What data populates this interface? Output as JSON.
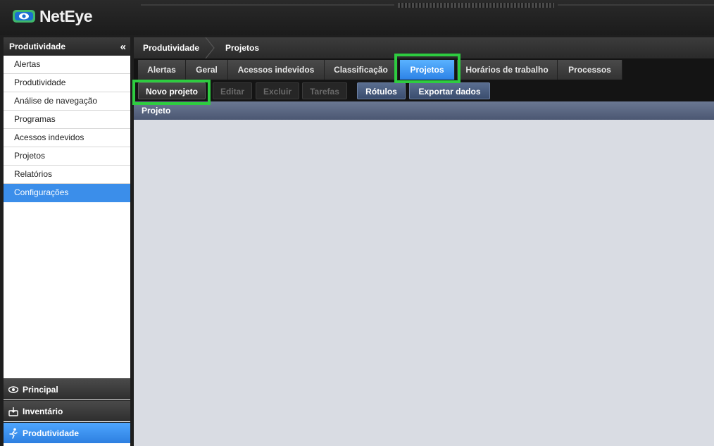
{
  "app": {
    "name": "NetEye",
    "brand_colors": {
      "header": "#1b1b1b",
      "accent": "#3b8eea",
      "highlight": "#2ecc40",
      "logo_blue": "#1b6fd1",
      "logo_green": "#3fb86b"
    }
  },
  "sidebar": {
    "title": "Produtividade",
    "collapse_icon": "double-chevron-left-icon",
    "collapse_glyph": "«",
    "items": [
      {
        "label": "Alertas"
      },
      {
        "label": "Produtividade"
      },
      {
        "label": "Análise de navegação"
      },
      {
        "label": "Programas"
      },
      {
        "label": "Acessos indevidos"
      },
      {
        "label": "Projetos"
      },
      {
        "label": "Relatórios"
      },
      {
        "label": "Configurações",
        "selected": true
      }
    ],
    "sections": [
      {
        "label": "Principal",
        "icon": "eye-icon"
      },
      {
        "label": "Inventário",
        "icon": "inbox-icon"
      },
      {
        "label": "Produtividade",
        "icon": "running-person-icon",
        "active": true
      }
    ]
  },
  "breadcrumb": {
    "items": [
      "Produtividade",
      "Projetos"
    ]
  },
  "tabs": [
    {
      "label": "Alertas"
    },
    {
      "label": "Geral"
    },
    {
      "label": "Acessos indevidos"
    },
    {
      "label": "Classificação"
    },
    {
      "label": "Projetos",
      "active": true
    },
    {
      "label": "Horários de trabalho"
    },
    {
      "label": "Processos"
    }
  ],
  "toolbar": {
    "buttons": [
      {
        "label": "Novo projeto",
        "enabled": true
      },
      {
        "label": "Editar",
        "enabled": false
      },
      {
        "label": "Excluir",
        "enabled": false
      },
      {
        "label": "Tarefas",
        "enabled": false
      },
      {
        "label": "Rótulos",
        "enabled": true
      },
      {
        "label": "Exportar dados",
        "enabled": true
      }
    ]
  },
  "grid": {
    "columns": [
      "Projeto"
    ],
    "rows": []
  }
}
